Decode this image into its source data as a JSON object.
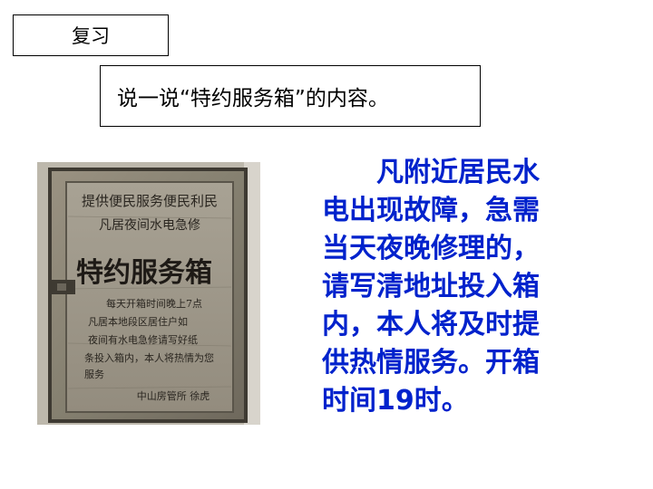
{
  "slide": {
    "label": "复习",
    "prompt": "说一说“特约服务箱”的内容。",
    "answer": "凡附近居民水电出现故障，急需当天夜晚修理的，请写清地址投入箱内，本人将及时提供热情服务。开箱时间19时。"
  },
  "photo": {
    "box_header_line1": "提供便民服务便民利民",
    "box_header_line2": "凡居夜间水电急修",
    "box_title": "特约服务箱",
    "box_text_lines": [
      "每天开箱时间晚上7点",
      "凡居本地段区居住户如",
      "夜间有水电急修请写好纸",
      "条投入箱内，本人将热情为您",
      "服务"
    ],
    "box_signature": "中山房管所    徐虎"
  },
  "colors": {
    "answer_text": "#0022cc",
    "photo_wood": "#8a8070"
  }
}
